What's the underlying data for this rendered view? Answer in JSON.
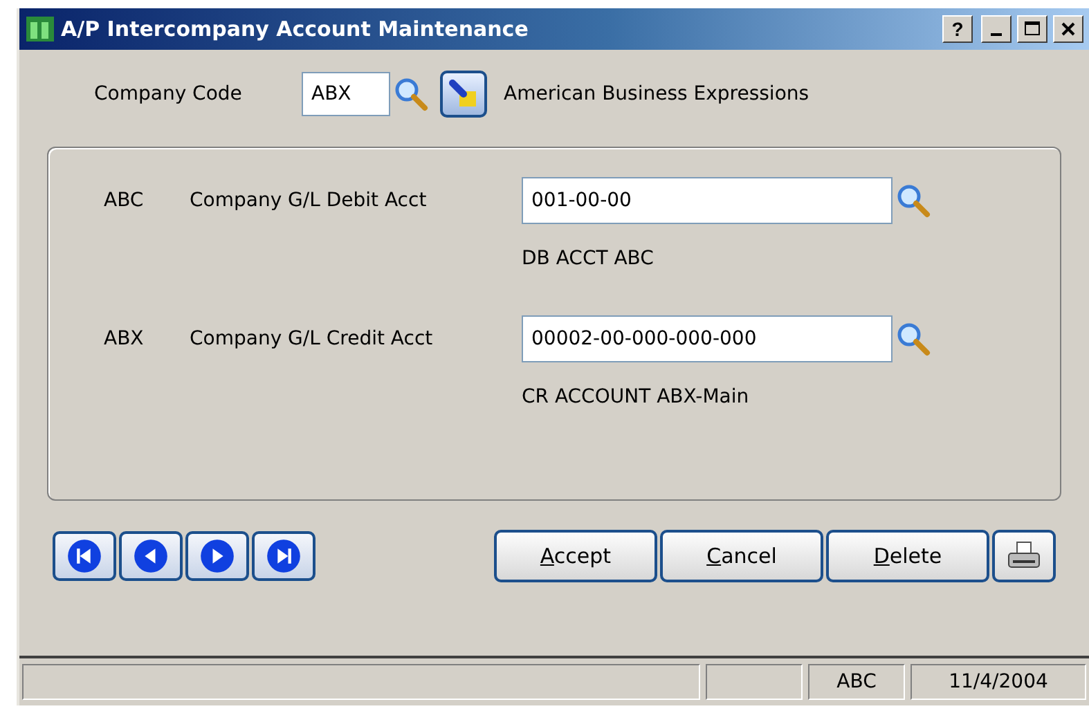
{
  "window": {
    "title": "A/P Intercompany Account Maintenance",
    "controls": [
      "?"
    ]
  },
  "company": {
    "label": "Company Code",
    "value": "ABX",
    "name": "American Business Expressions"
  },
  "accounts": [
    {
      "company": "ABC",
      "label": "Company G/L Debit Acct",
      "value": "001-00-00",
      "description": "DB ACCT ABC"
    },
    {
      "company": "ABX",
      "label": "Company G/L Credit Acct",
      "value": "00002-00-000-000-000",
      "description": "CR ACCOUNT ABX-Main"
    }
  ],
  "nav_buttons": [
    {
      "kind": "first"
    },
    {
      "kind": "previous"
    },
    {
      "kind": "next"
    },
    {
      "kind": "last"
    }
  ],
  "action_buttons": [
    "Accept",
    "Cancel",
    "Delete"
  ],
  "status_bar": {
    "company": "ABC",
    "date": "11/4/2004"
  }
}
